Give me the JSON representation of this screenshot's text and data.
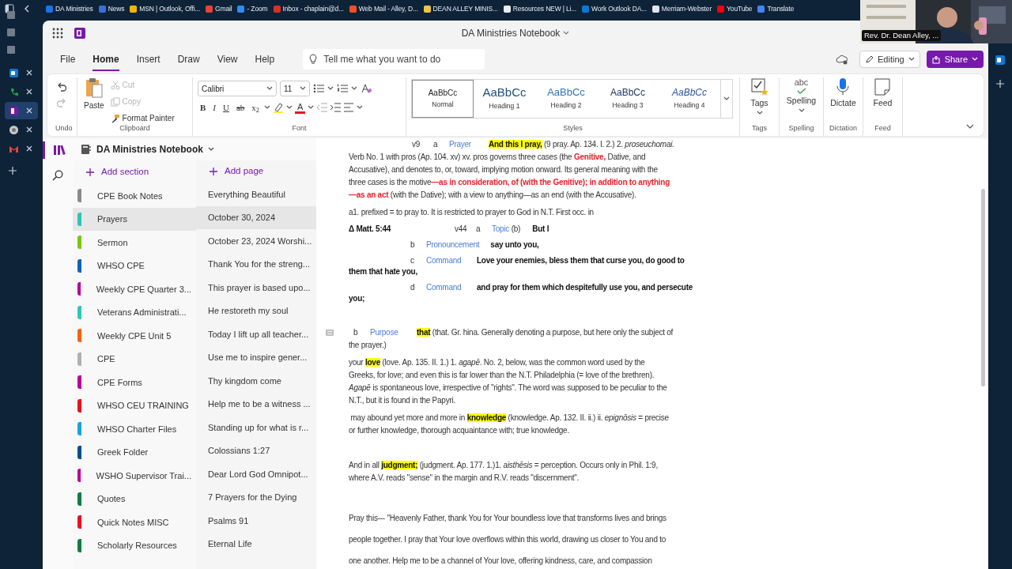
{
  "bookmarks": [
    {
      "label": "DA Ministries",
      "color": "#1a73e8"
    },
    {
      "label": "News",
      "color": "#3b6fd8"
    },
    {
      "label": "MSN | Outlook, Offi...",
      "color": "#f2b705"
    },
    {
      "label": "Gmail",
      "color": "#ea4335"
    },
    {
      "label": "- Zoom",
      "color": "#2d8cff"
    },
    {
      "label": "Inbox - chaplain@d...",
      "color": "#d93025"
    },
    {
      "label": "Web Mail - Alley, D...",
      "color": "#f25022"
    },
    {
      "label": "DEAN ALLEY MINIS...",
      "color": "#f4c542"
    },
    {
      "label": "Resources NEW | Li...",
      "color": "#e8eef6"
    },
    {
      "label": "Work Outlook DA...",
      "color": "#0f78d4"
    },
    {
      "label": "Merriam-Webster",
      "color": "#dfe6ee"
    },
    {
      "label": "YouTube",
      "color": "#ff0000"
    },
    {
      "label": "Translate",
      "color": "#4285f4"
    }
  ],
  "video_tile": {
    "label": "Rev. Dr. Dean Alley, ..."
  },
  "browser_tabs": [
    {
      "kind": "mail",
      "color": "#0f78d4",
      "selected": false
    },
    {
      "kind": "phone",
      "color": "#22a547",
      "selected": false
    },
    {
      "kind": "notes",
      "color": "#7719aa",
      "selected": true
    },
    {
      "kind": "circle",
      "color": "#c8c8c8",
      "selected": false
    },
    {
      "kind": "gmail",
      "color": "#ea4335",
      "selected": false
    }
  ],
  "app": {
    "title": "DA Ministries Notebook"
  },
  "menu_tabs": [
    {
      "label": "File",
      "selected": false
    },
    {
      "label": "Home",
      "selected": true
    },
    {
      "label": "Insert",
      "selected": false
    },
    {
      "label": "Draw",
      "selected": false
    },
    {
      "label": "View",
      "selected": false
    },
    {
      "label": "Help",
      "selected": false
    }
  ],
  "search": {
    "placeholder": "Tell me what you want to do"
  },
  "mode_button": "Editing",
  "share_button": "Share",
  "ribbon": {
    "history": {
      "label": "Undo",
      "buttons": [
        {
          "kind": "undo",
          "disabled": false
        },
        {
          "kind": "redo",
          "disabled": true
        }
      ]
    },
    "clipboard": {
      "label": "Clipboard",
      "paste": "Paste",
      "items": [
        {
          "kind": "cut",
          "label": "Cut",
          "disabled": true
        },
        {
          "kind": "copy",
          "label": "Copy",
          "disabled": true
        },
        {
          "kind": "painter",
          "label": "Format Painter",
          "disabled": false
        }
      ]
    },
    "font": {
      "label": "Font",
      "family": "Calibri",
      "size": "11",
      "format": [
        {
          "kind": "bold",
          "text": "B"
        },
        {
          "kind": "italic",
          "text": "I"
        },
        {
          "kind": "underline",
          "text": "U"
        },
        {
          "kind": "strike",
          "text": "ab"
        },
        {
          "kind": "subscript",
          "text": "x$_{2}$"
        },
        {
          "kind": "color",
          "text": "A"
        }
      ]
    },
    "styles": {
      "label": "Styles",
      "items": [
        {
          "kind": "normal",
          "sample": "AaBbCc",
          "name": "Normal",
          "selected": true
        },
        {
          "kind": "h1",
          "sample": "AaBbCc",
          "name": "Heading 1",
          "selected": false
        },
        {
          "kind": "h2",
          "sample": "AaBbCc",
          "name": "Heading 2",
          "selected": false
        },
        {
          "kind": "h3",
          "sample": "AaBbCc",
          "name": "Heading 3",
          "selected": false
        },
        {
          "kind": "h4",
          "sample": "AaBbCc",
          "name": "Heading 4",
          "selected": false
        }
      ]
    },
    "commands": [
      {
        "kind": "tags",
        "label": "Tags",
        "group": "Tags",
        "dropdown": true
      },
      {
        "kind": "spelling",
        "label": "Spelling",
        "icon_text": "abc",
        "group": "Spelling",
        "dropdown": true
      },
      {
        "kind": "dictate",
        "label": "Dictate",
        "group": "Dictation",
        "dropdown": false
      },
      {
        "kind": "feed",
        "label": "Feed",
        "group": "Feed",
        "dropdown": false
      }
    ]
  },
  "notebook": {
    "name": "DA Ministries Notebook"
  },
  "add_section": "Add section",
  "add_page": "Add page",
  "sections": [
    {
      "name": "CPE Book Notes",
      "color": "#8a8a8a",
      "selected": false
    },
    {
      "name": "Prayers",
      "color": "#2ec4b6",
      "selected": true
    },
    {
      "name": "Sermon",
      "color": "#7ac70c",
      "selected": false
    },
    {
      "name": "WHSO CPE",
      "color": "#0f62b5",
      "selected": false
    },
    {
      "name": "Weekly CPE Quarter 3...",
      "color": "#b4009e",
      "selected": false
    },
    {
      "name": "Veterans Administrati...",
      "color": "#2fc7b8",
      "selected": false
    },
    {
      "name": "Weekly CPE Unit 5",
      "color": "#f7630c",
      "selected": false
    },
    {
      "name": "CPE",
      "color": "#b0b0b0",
      "selected": false
    },
    {
      "name": "CPE Forms",
      "color": "#b4009e",
      "selected": false
    },
    {
      "name": "WHSO CEU TRAINING",
      "color": "#e81123",
      "selected": false
    },
    {
      "name": "WHSO Charter Files",
      "color": "#1ba1e2",
      "selected": false
    },
    {
      "name": "Greek Folder",
      "color": "#004e8c",
      "selected": false
    },
    {
      "name": "WSHO Supervisor Trai...",
      "color": "#b4009e",
      "selected": false
    },
    {
      "name": "Quotes",
      "color": "#107c41",
      "selected": false
    },
    {
      "name": "Quick Notes MISC",
      "color": "#e81123",
      "selected": false
    },
    {
      "name": "Scholarly Resources",
      "color": "#107c41",
      "selected": false
    }
  ],
  "pages": [
    {
      "title": "Everything Beautiful",
      "selected": false
    },
    {
      "title": "October 30, 2024",
      "selected": true
    },
    {
      "title": "October 23, 2024 Worshi...",
      "selected": false
    },
    {
      "title": "Thank You for the streng...",
      "selected": false
    },
    {
      "title": "This prayer is based upo...",
      "selected": false
    },
    {
      "title": "He restoreth my soul",
      "selected": false
    },
    {
      "title": "Today I lift up all teacher...",
      "selected": false
    },
    {
      "title": "Use me to inspire gener...",
      "selected": false
    },
    {
      "title": "Thy kingdom come",
      "selected": false
    },
    {
      "title": "Help me to be a witness ...",
      "selected": false
    },
    {
      "title": "Standing up for what is r...",
      "selected": false
    },
    {
      "title": "Colossians 1:27",
      "selected": false
    },
    {
      "title": "Dear Lord God Omnipot...",
      "selected": false
    },
    {
      "title": "7 Prayers for the Dying",
      "selected": false
    },
    {
      "title": "Psalms 91",
      "selected": false
    },
    {
      "title": "Eternal Life",
      "selected": false
    }
  ],
  "note": [
    {
      "kind": "text",
      "hovered": false,
      "lines": [
        {
          "kind": "outline",
          "verse": "v9",
          "letter": "a",
          "label": "Prayer",
          "runs": [
            {
              "kind": "highlight",
              "text": "And this I pray,"
            },
            {
              "kind": "plain",
              "text": " (9 pray. Ap. 134. I. 2.) 2. "
            },
            {
              "kind": "italic",
              "text": "proseuchomai."
            }
          ]
        },
        {
          "kind": "text",
          "runs": [
            {
              "kind": "plain",
              "text": "Verb No. 1 with pros (Ap. 104. xv) xv. pros governs three cases (the "
            },
            {
              "kind": "red",
              "text": "Genitive,"
            },
            {
              "kind": "plain",
              "text": " Dative, and"
            }
          ]
        },
        {
          "kind": "text",
          "runs": [
            {
              "kind": "plain",
              "text": "Accusative), and denotes to, or, toward, implying motion onward. Its general meaning with the"
            }
          ]
        },
        {
          "kind": "text",
          "runs": [
            {
              "kind": "plain",
              "text": "three cases is the motive"
            },
            {
              "kind": "red",
              "text": "—as in consideration, of (with the Genitive); in addition to anything"
            }
          ]
        },
        {
          "kind": "text",
          "runs": [
            {
              "kind": "red",
              "text": "—as an act"
            },
            {
              "kind": "plain",
              "text": " (with the Dative); with a view to anything—as an end (with the Accusative)."
            }
          ]
        }
      ]
    },
    {
      "kind": "text",
      "hovered": false,
      "lines": [
        {
          "kind": "text",
          "runs": [
            {
              "kind": "plain",
              "text": "a1. prefixed = to pray to. It is restricted to prayer to God in N.T. First occ. in"
            }
          ]
        }
      ]
    },
    {
      "kind": "outline",
      "hovered": false,
      "lines": [
        {
          "kind": "outline",
          "lead": "Δ Matt. 5:44",
          "verse": "v44",
          "letter": "a",
          "label": "Topic",
          "runs": [
            {
              "kind": "plain",
              "text": " (b)      "
            },
            {
              "kind": "bold",
              "text": "But I"
            }
          ]
        }
      ]
    },
    {
      "kind": "outline",
      "hovered": false,
      "lines": [
        {
          "kind": "outline",
          "letter": "b",
          "label": "Pronouncement",
          "runs": [
            {
              "kind": "bold",
              "text": "say unto you,"
            }
          ]
        }
      ]
    },
    {
      "kind": "outline",
      "hovered": false,
      "lines": [
        {
          "kind": "outline",
          "letter": "c",
          "label": "Command",
          "runs": [
            {
              "kind": "bold",
              "text": "Love your enemies, bless them that curse you, do good to"
            }
          ]
        },
        {
          "kind": "text",
          "runs": [
            {
              "kind": "bold",
              "text": "them that hate you,"
            }
          ]
        }
      ]
    },
    {
      "kind": "outline",
      "hovered": false,
      "lines": [
        {
          "kind": "outline",
          "letter": "d",
          "label": "Command",
          "runs": [
            {
              "kind": "bold",
              "text": "and pray for them which despitefully use you, and persecute"
            }
          ]
        },
        {
          "kind": "text",
          "runs": [
            {
              "kind": "bold",
              "text": "you;"
            }
          ]
        }
      ]
    },
    {
      "kind": "break",
      "hovered": true,
      "lines": [
        {
          "kind": "outline-flush",
          "letter": "b",
          "label": "Purpose",
          "runs": [
            {
              "kind": "highlight",
              "text": "that"
            },
            {
              "kind": "plain",
              "text": " (that. Gr. hina. Generally denoting a purpose, but here only the subject of"
            }
          ]
        },
        {
          "kind": "text",
          "runs": [
            {
              "kind": "plain",
              "text": "the prayer.)"
            }
          ]
        }
      ]
    },
    {
      "kind": "text",
      "hovered": false,
      "lines": [
        {
          "kind": "text",
          "runs": [
            {
              "kind": "plain",
              "text": "your "
            },
            {
              "kind": "highlight",
              "text": "love"
            },
            {
              "kind": "plain",
              "text": " (love. Ap. 135. II. 1.) 1. "
            },
            {
              "kind": "italic",
              "text": "agapē"
            },
            {
              "kind": "plain",
              "text": ". No. 2, below, was the common word used by the"
            }
          ]
        },
        {
          "kind": "text",
          "runs": [
            {
              "kind": "plain",
              "text": "Greeks, for love; and even this is far lower than the N.T. Philadelphia (= love of the brethren)."
            }
          ]
        },
        {
          "kind": "text",
          "runs": [
            {
              "kind": "italic",
              "text": "Agapē"
            },
            {
              "kind": "plain",
              "text": " is spontaneous love, irrespective of \"rights\". The word was supposed to be peculiar to the"
            }
          ]
        },
        {
          "kind": "text",
          "runs": [
            {
              "kind": "plain",
              "text": "N.T., but it is found in the Papyri."
            }
          ]
        }
      ]
    },
    {
      "kind": "text",
      "hovered": false,
      "lines": [
        {
          "kind": "text",
          "runs": [
            {
              "kind": "plain",
              "text": " may abound yet more and more in "
            },
            {
              "kind": "highlight",
              "text": "knowledge"
            },
            {
              "kind": "plain",
              "text": " (knowledge. Ap. 132. II. ii.) ii. "
            },
            {
              "kind": "italic",
              "text": "epignōsis"
            },
            {
              "kind": "plain",
              "text": " = precise"
            }
          ]
        },
        {
          "kind": "text",
          "runs": [
            {
              "kind": "plain",
              "text": "or further knowledge, thorough acquaintance with; true knowledge."
            }
          ]
        }
      ]
    },
    {
      "kind": "break",
      "hovered": false,
      "lines": [
        {
          "kind": "text",
          "runs": [
            {
              "kind": "plain",
              "text": "And in all "
            },
            {
              "kind": "highlight",
              "text": "judgment;"
            },
            {
              "kind": "plain",
              "text": " (judgment. Ap. 177. 1.)1. "
            },
            {
              "kind": "italic",
              "text": "aisthēsis"
            },
            {
              "kind": "plain",
              "text": " = perception. Occurs only in Phil. 1:9,"
            }
          ]
        },
        {
          "kind": "text",
          "runs": [
            {
              "kind": "plain",
              "text": "where A.V. reads \"sense\" in the margin and R.V. reads \"discernment\"."
            }
          ]
        }
      ]
    },
    {
      "kind": "prayer",
      "hovered": false,
      "lines": [
        {
          "kind": "text",
          "runs": [
            {
              "kind": "plain",
              "text": "Pray this--- \"Heavenly Father, thank You for Your boundless love that transforms lives and brings"
            }
          ]
        },
        {
          "kind": "text",
          "runs": [
            {
              "kind": "plain",
              "text": "people together. I pray that Your love overflows within this world, drawing us closer to You and to"
            }
          ]
        },
        {
          "kind": "text",
          "runs": [
            {
              "kind": "plain",
              "text": "one another. Help me to be a channel of Your love, offering kindness, care, and compassion"
            }
          ]
        }
      ]
    }
  ]
}
